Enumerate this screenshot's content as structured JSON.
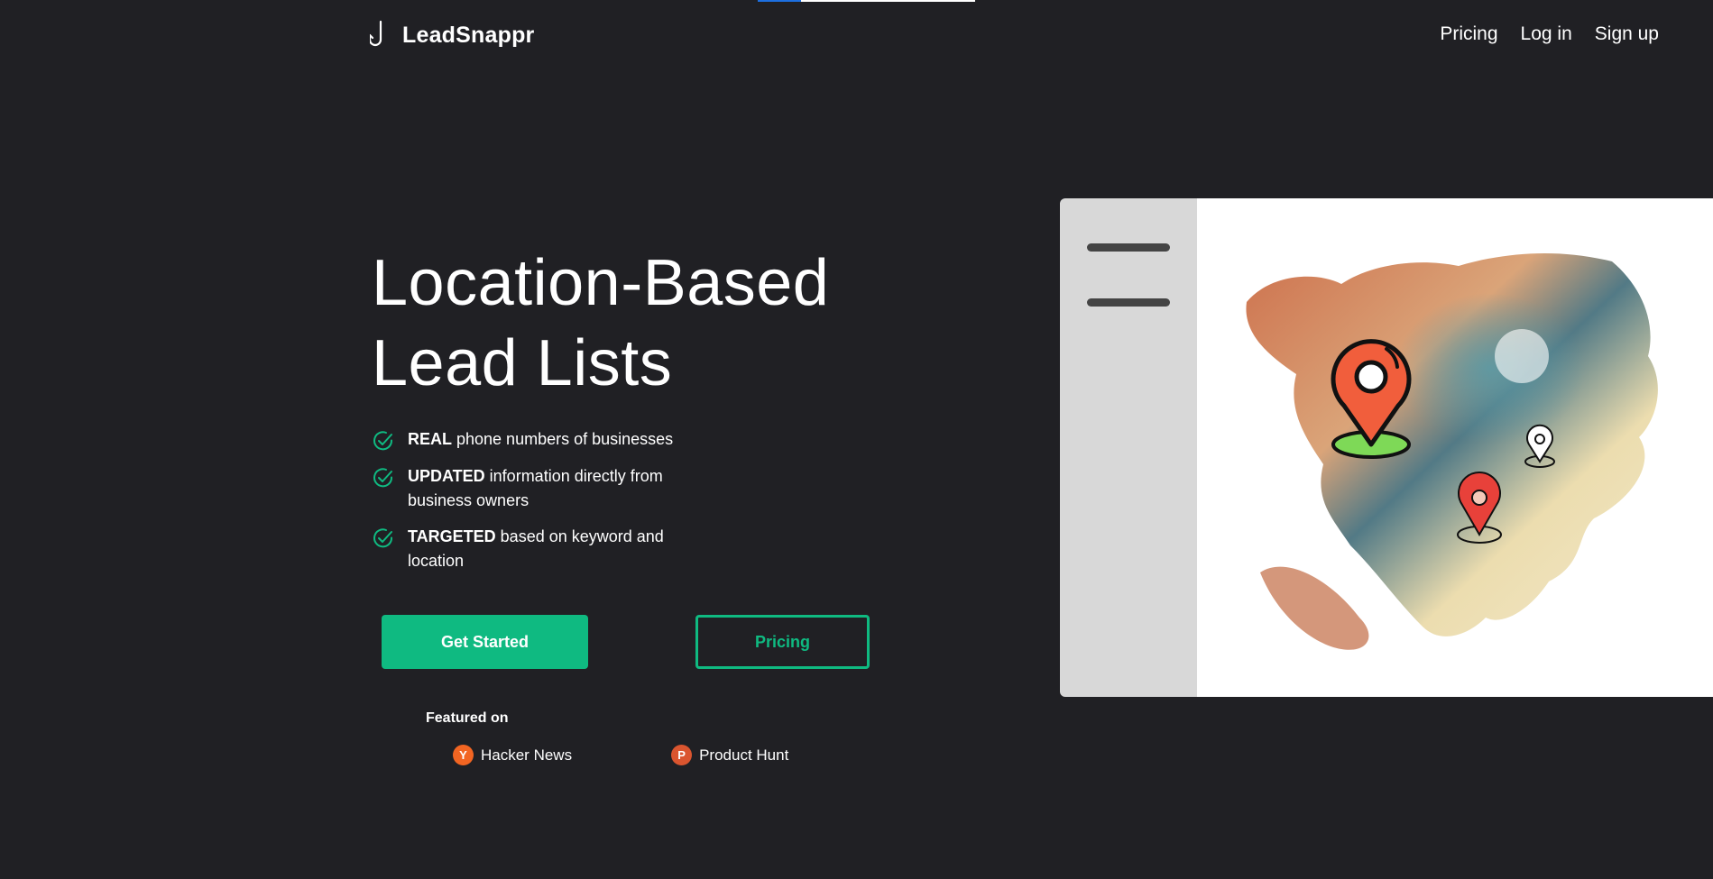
{
  "app": {
    "name": "LeadSnappr"
  },
  "colors": {
    "background": "#202024",
    "accent": "#0fba81",
    "hacker_news": "#f26522",
    "product_hunt": "#da552f"
  },
  "nav": {
    "items": [
      "Pricing",
      "Log in",
      "Sign up"
    ]
  },
  "hero": {
    "title_line1": "Location-Based",
    "title_line2": "Lead Lists",
    "features": [
      {
        "bold": "REAL",
        "text": " phone numbers of businesses"
      },
      {
        "bold": "UPDATED",
        "text": " information directly from business owners"
      },
      {
        "bold": "TARGETED",
        "text": " based on keyword and location"
      }
    ],
    "cta_primary": "Get Started",
    "cta_secondary": "Pricing"
  },
  "featured": {
    "label": "Featured on",
    "items": [
      {
        "badge": "Y",
        "label": "Hacker News",
        "icon": "hacker-news-icon"
      },
      {
        "badge": "P",
        "label": "Product Hunt",
        "icon": "product-hunt-icon"
      }
    ]
  },
  "icons": {
    "brand": "fishing-hook-icon",
    "feature": "check-circle-icon",
    "illustration": "north-america-map-with-location-pins"
  }
}
